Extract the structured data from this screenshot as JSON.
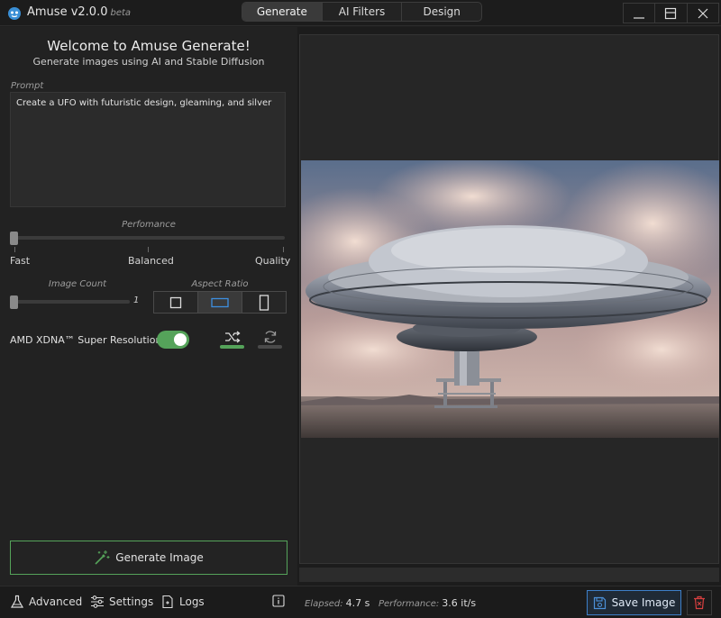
{
  "app": {
    "name": "Amuse v2.0.0",
    "beta": "beta"
  },
  "tabs": [
    {
      "label": "Generate",
      "active": true
    },
    {
      "label": "AI Filters"
    },
    {
      "label": "Design"
    }
  ],
  "window_controls": {
    "minimize": "minimize-icon",
    "maximize": "maximize-icon",
    "close": "close-icon"
  },
  "welcome": {
    "title": "Welcome to Amuse Generate!",
    "subtitle": "Generate images using AI and Stable Diffusion"
  },
  "prompt": {
    "label": "Prompt",
    "value": "Create a UFO with futuristic design, gleaming, and silver"
  },
  "performance": {
    "label": "Perfomance",
    "options": [
      "Fast",
      "Balanced",
      "Quality"
    ],
    "selected": "Fast"
  },
  "image_count": {
    "label": "Image Count",
    "value": "1"
  },
  "aspect_ratio": {
    "label": "Aspect Ratio",
    "options": [
      "square-icon",
      "landscape-icon",
      "portrait-icon"
    ],
    "selected": "landscape-icon"
  },
  "super_resolution": {
    "label": "AMD XDNA™ Super Resolution",
    "enabled": true
  },
  "seed": {
    "random_icon": "shuffle-icon",
    "reuse_icon": "refresh-icon",
    "random_active": true
  },
  "generate": {
    "label": "Generate Image"
  },
  "footer": {
    "advanced": "Advanced",
    "settings": "Settings",
    "logs": "Logs",
    "elapsed_label": "Elapsed:",
    "elapsed_value": "4.7 s",
    "performance_label": "Performance:",
    "performance_value": "3.6 it/s",
    "save": "Save Image"
  },
  "colors": {
    "accent_green": "#55a35a",
    "accent_blue": "#3d7fc9",
    "delete_red": "#d94040",
    "background": "#1f1f1f"
  }
}
